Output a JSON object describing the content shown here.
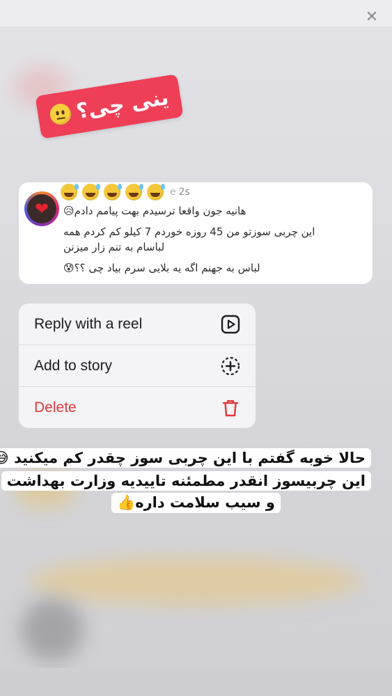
{
  "header": {
    "close_icon": "close-icon"
  },
  "sticker": {
    "text": "ینی چی؟",
    "emoji": "neutral-face-emoji"
  },
  "message": {
    "reactions": [
      "sweat-smile-emoji",
      "sweat-smile-emoji",
      "sweat-smile-emoji",
      "sweat-smile-emoji",
      "sweat-smile-emoji"
    ],
    "sender_partial": "e",
    "time": "2s",
    "lines": [
      "هانیه جون واقعا ترسیدم بهت پیامم دادم😥",
      "این چربی سوزتو من 45 روزه خوردم 7 کیلو کم کردم همه",
      "لباسام به تنم زار میزنن",
      "لباس به جهنم اگه یه بلایی سرم بیاد چی ؟؟😰"
    ]
  },
  "menu": {
    "items": [
      {
        "label": "Reply with a reel",
        "icon": "reel-icon",
        "color": "#1c1c1e"
      },
      {
        "label": "Add to story",
        "icon": "add-story-icon",
        "color": "#1c1c1e"
      },
      {
        "label": "Delete",
        "icon": "trash-icon",
        "color": "#e0393e"
      }
    ]
  },
  "caption": {
    "lines": [
      "حالا خوبه گفتم با این چربی سوز چقدر کم میکنید 😅",
      "این چربیسوز انقدر مطمئنه تاییدیه وزارت بهداشت",
      "و سیب سلامت داره👍"
    ]
  }
}
